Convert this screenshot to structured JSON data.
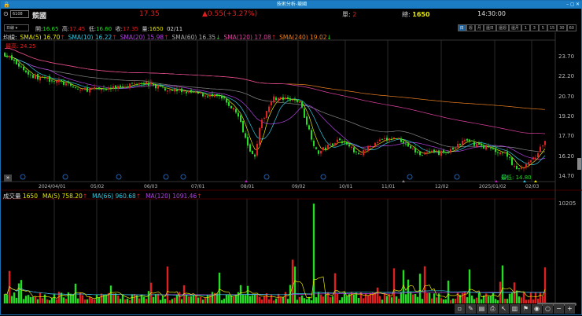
{
  "window": {
    "title": "技術分析-競國",
    "controls": "–  ◻  ✕"
  },
  "header": {
    "code": "6108",
    "name": "競國",
    "price": "17.35",
    "change": "▲0.55(+3.27%)",
    "single_label": "單:",
    "single": "2",
    "total_label": "總:",
    "total": "1650",
    "time": "14:30:00"
  },
  "quote": {
    "period": "日線",
    "open_label": "開:",
    "open": "16.65",
    "high_label": "高:",
    "high": "17.45",
    "low_label": "低:",
    "low": "16.60",
    "close_label": "收:",
    "close": "17.35",
    "vol_label": "量:",
    "vol": "1650",
    "date": "02/11"
  },
  "period_tabs": [
    "日",
    "週",
    "月",
    "還日",
    "還週",
    "還月",
    "1",
    "3",
    "5",
    "15",
    "30",
    "60"
  ],
  "ma_legend": {
    "label": "均線:",
    "items": [
      {
        "text": "SMA(5) 16.70",
        "arrow": "↑",
        "color": "#e8e800"
      },
      {
        "text": "SMA(10) 16.22",
        "arrow": "↑",
        "color": "#30c8e0"
      },
      {
        "text": "SMA(20) 15.98",
        "arrow": "↑",
        "color": "#b040e0"
      },
      {
        "text": "SMA(60) 16.35",
        "arrow": "↓",
        "color": "#aaaaaa"
      },
      {
        "text": "SMA(120) 17.08",
        "arrow": "↑",
        "color": "#e040a0"
      },
      {
        "text": "SMA(240) 19.02",
        "arrow": "↓",
        "color": "#f08020"
      }
    ]
  },
  "price_axis": [
    "23.70",
    "22.20",
    "20.70",
    "19.20",
    "17.70",
    "16.20",
    "14.70"
  ],
  "highest": "最高: 24.25",
  "lowest": "最低: 14.80",
  "dates": [
    "2024/04/01",
    "05/02",
    "06/03",
    "07/01",
    "08/01",
    "09/02",
    "10/01",
    "11/01",
    "12/02",
    "2025/01/02",
    "02/03"
  ],
  "volume": {
    "label": "成交量",
    "value": "1650",
    "items": [
      {
        "text": "MA(5) 758.20",
        "arrow": "↑",
        "color": "#e8e800"
      },
      {
        "text": "MA(66) 960.68",
        "arrow": "↑",
        "color": "#30c8e0"
      },
      {
        "text": "MA(120) 1091.46",
        "arrow": "↑",
        "color": "#b040e0"
      }
    ],
    "axis_max": "10205"
  },
  "colors": {
    "up": "#e02020",
    "down": "#22dd22",
    "titlebar": "#1b7cc4"
  },
  "toolbar": [
    "pin-icon",
    "draw-icon",
    "note-icon",
    "print-icon",
    "cursor-icon",
    "layout-icon",
    "indicator-icon",
    "eye-icon",
    "circle-icon",
    "zoom-out-icon",
    "zoom-in-icon"
  ]
}
